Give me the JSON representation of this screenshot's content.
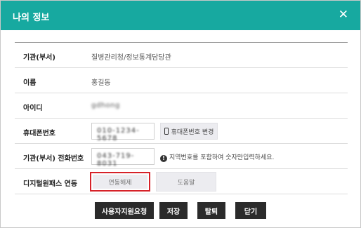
{
  "header": {
    "title": "나의 정보",
    "close_label": "✕"
  },
  "rows": [
    {
      "label": "기관(부서)",
      "value": "질병관리청/정보통계담당관"
    },
    {
      "label": "이름",
      "value": "홍길동"
    },
    {
      "label": "아이디",
      "value": "gdhong"
    },
    {
      "label": "휴대폰번호",
      "value": "010-1234-5678"
    },
    {
      "label": "기관(부서) 전화번호",
      "value": "043-719-8031"
    },
    {
      "label": "디지털원패스 연동"
    }
  ],
  "phone_change_label": "휴대폰번호 변경",
  "phone_hint": "지역번호를 포함하여 숫자만입력하세요.",
  "onepass": {
    "unlink_label": "연동해제",
    "help_label": "도움말"
  },
  "footer": {
    "request_label": "사용자지원요청",
    "save_label": "저장",
    "withdraw_label": "탈퇴",
    "close_label": "닫기"
  },
  "colors": {
    "header_bg": "#17a9a0",
    "highlight": "#d62128",
    "footer_btn": "#2b2b2b"
  }
}
